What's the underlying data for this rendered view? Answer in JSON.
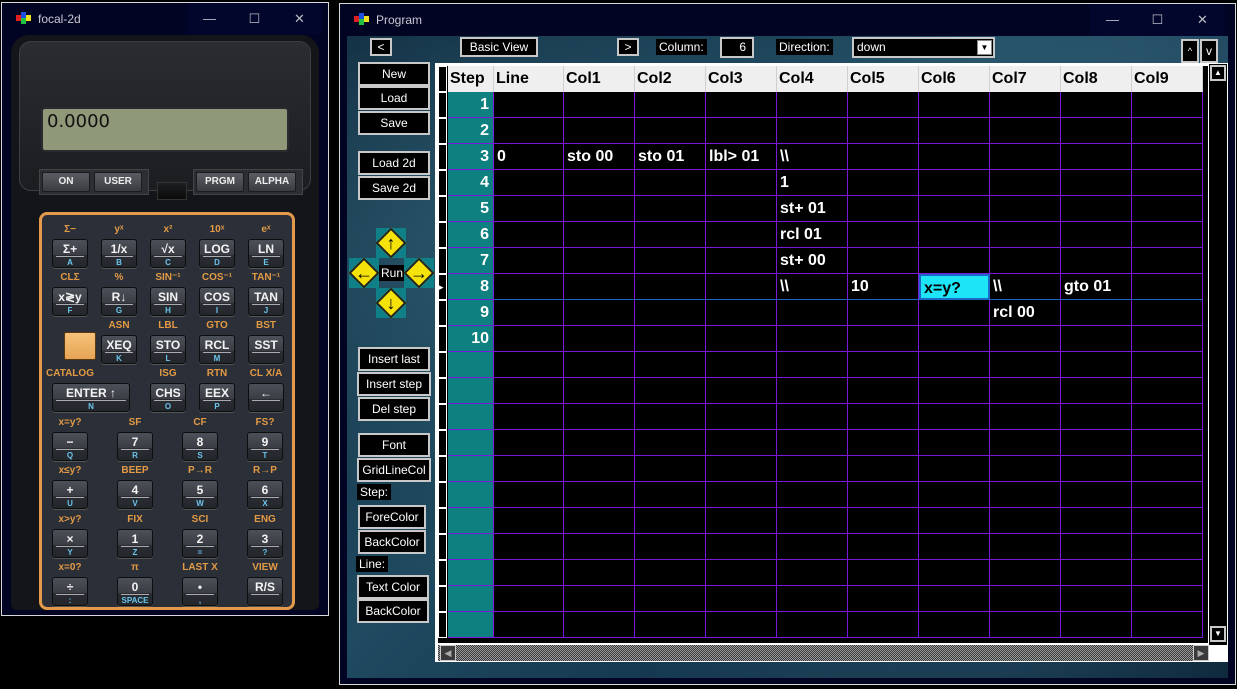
{
  "calculator_window": {
    "title": "focal-2d",
    "controls": {
      "minimize": "—",
      "maximize": "☐",
      "close": "✕"
    },
    "display": "0.0000",
    "top_buttons": [
      "ON",
      "USER",
      "PRGM",
      "ALPHA"
    ],
    "keys": [
      {
        "main": "Σ+",
        "sub": "A",
        "shift": "Σ−"
      },
      {
        "main": "1/x",
        "sub": "B",
        "shift": "yˣ"
      },
      {
        "main": "√x",
        "sub": "C",
        "shift": "x²"
      },
      {
        "main": "LOG",
        "sub": "D",
        "shift": "10ˣ"
      },
      {
        "main": "LN",
        "sub": "E",
        "shift": "eˣ"
      },
      {
        "main": "x≷y",
        "sub": "F",
        "shift": "CLΣ"
      },
      {
        "main": "R↓",
        "sub": "G",
        "shift": "%"
      },
      {
        "main": "SIN",
        "sub": "H",
        "shift": "SIN⁻¹"
      },
      {
        "main": "COS",
        "sub": "I",
        "shift": "COS⁻¹"
      },
      {
        "main": "TAN",
        "sub": "J",
        "shift": "TAN⁻¹"
      },
      {
        "main": "XEQ",
        "sub": "K",
        "shift": "ASN"
      },
      {
        "main": "STO",
        "sub": "L",
        "shift": "LBL"
      },
      {
        "main": "RCL",
        "sub": "M",
        "shift": "GTO"
      },
      {
        "main": "SST",
        "sub": "",
        "shift": "BST"
      },
      {
        "main": "ENTER ↑",
        "sub": "N",
        "shift": "CATALOG"
      },
      {
        "main": "CHS",
        "sub": "O",
        "shift": "ISG"
      },
      {
        "main": "EEX",
        "sub": "P",
        "shift": "RTN"
      },
      {
        "main": "←",
        "sub": "",
        "shift": "CL X/A"
      },
      {
        "main": "−",
        "sub": "Q",
        "shift": "x=y?"
      },
      {
        "main": "7",
        "sub": "R",
        "shift": "SF"
      },
      {
        "main": "8",
        "sub": "S",
        "shift": "CF"
      },
      {
        "main": "9",
        "sub": "T",
        "shift": "FS?"
      },
      {
        "main": "+",
        "sub": "U",
        "shift": "x≤y?"
      },
      {
        "main": "4",
        "sub": "V",
        "shift": "BEEP"
      },
      {
        "main": "5",
        "sub": "W",
        "shift": "P→R"
      },
      {
        "main": "6",
        "sub": "X",
        "shift": "R→P"
      },
      {
        "main": "×",
        "sub": "Y",
        "shift": "x>y?"
      },
      {
        "main": "1",
        "sub": "Z",
        "shift": "FIX"
      },
      {
        "main": "2",
        "sub": "=",
        "shift": "SCI"
      },
      {
        "main": "3",
        "sub": "?",
        "shift": "ENG"
      },
      {
        "main": "÷",
        "sub": ":",
        "shift": "x=0?"
      },
      {
        "main": "0",
        "sub": "SPACE",
        "shift": "π"
      },
      {
        "main": "•",
        "sub": ",",
        "shift": "LAST X"
      },
      {
        "main": "R/S",
        "sub": "",
        "shift": "VIEW"
      }
    ],
    "colors": {
      "shift_label": "#e29a45",
      "alpha_label": "#6bc6ee",
      "bezel": "#e39a4a",
      "lcd": "#8f9878"
    }
  },
  "program_window": {
    "title": "Program",
    "controls": {
      "minimize": "—",
      "maximize": "☐",
      "close": "✕"
    },
    "toolbar": {
      "prev": "<",
      "basic_view": "Basic View",
      "next": ">",
      "column_label": "Column:",
      "column_value": "6",
      "direction_label": "Direction:",
      "direction_value": "down",
      "scroll_up": "^",
      "scroll_down": "v"
    },
    "side_buttons": {
      "new": "New",
      "load": "Load",
      "save": "Save",
      "load2d": "Load 2d",
      "save2d": "Save 2d",
      "run": "Run",
      "insert_last": "Insert last",
      "insert_step": "Insert step",
      "del_step": "Del step",
      "font": "Font",
      "gridlinecol": "GridLineCol",
      "step_label": "Step:",
      "step_forecolor": "ForeColor",
      "step_backcolor": "BackColor",
      "line_label": "Line:",
      "line_textcolor": "Text Color",
      "line_backcolor": "BackColor"
    },
    "grid": {
      "headers": [
        "Step",
        "Line",
        "Col1",
        "Col2",
        "Col3",
        "Col4",
        "Col5",
        "Col6",
        "Col7",
        "Col8",
        "Col9"
      ],
      "selected_row": 8,
      "selected_col": "Col6",
      "rows": [
        {
          "step": "1",
          "cells": [
            "",
            "",
            "",
            "",
            "",
            "",
            "",
            "",
            "",
            ""
          ]
        },
        {
          "step": "2",
          "cells": [
            "",
            "",
            "",
            "",
            "",
            "",
            "",
            "",
            "",
            ""
          ]
        },
        {
          "step": "3",
          "cells": [
            "0",
            "sto 00",
            "sto 01",
            "lbl> 01",
            "\\\\",
            "",
            "",
            "",
            "",
            ""
          ]
        },
        {
          "step": "4",
          "cells": [
            "",
            "",
            "",
            "",
            "1",
            "",
            "",
            "",
            "",
            ""
          ]
        },
        {
          "step": "5",
          "cells": [
            "",
            "",
            "",
            "",
            "st+ 01",
            "",
            "",
            "",
            "",
            ""
          ]
        },
        {
          "step": "6",
          "cells": [
            "",
            "",
            "",
            "",
            "rcl 01",
            "",
            "",
            "",
            "",
            ""
          ]
        },
        {
          "step": "7",
          "cells": [
            "",
            "",
            "",
            "",
            "st+ 00",
            "",
            "",
            "",
            "",
            ""
          ]
        },
        {
          "step": "8",
          "cells": [
            "",
            "",
            "",
            "",
            "\\\\",
            "10",
            "x=y?",
            "\\\\",
            "gto 01",
            ""
          ]
        },
        {
          "step": "9",
          "cells": [
            "",
            "",
            "",
            "",
            "",
            "",
            "",
            "rcl 00",
            "",
            ""
          ]
        },
        {
          "step": "10",
          "cells": [
            "",
            "",
            "",
            "",
            "",
            "",
            "",
            "",
            "",
            ""
          ]
        },
        {
          "step": "",
          "cells": [
            "",
            "",
            "",
            "",
            "",
            "",
            "",
            "",
            "",
            ""
          ]
        },
        {
          "step": "",
          "cells": [
            "",
            "",
            "",
            "",
            "",
            "",
            "",
            "",
            "",
            ""
          ]
        },
        {
          "step": "",
          "cells": [
            "",
            "",
            "",
            "",
            "",
            "",
            "",
            "",
            "",
            ""
          ]
        },
        {
          "step": "",
          "cells": [
            "",
            "",
            "",
            "",
            "",
            "",
            "",
            "",
            "",
            ""
          ]
        },
        {
          "step": "",
          "cells": [
            "",
            "",
            "",
            "",
            "",
            "",
            "",
            "",
            "",
            ""
          ]
        },
        {
          "step": "",
          "cells": [
            "",
            "",
            "",
            "",
            "",
            "",
            "",
            "",
            "",
            ""
          ]
        },
        {
          "step": "",
          "cells": [
            "",
            "",
            "",
            "",
            "",
            "",
            "",
            "",
            "",
            ""
          ]
        },
        {
          "step": "",
          "cells": [
            "",
            "",
            "",
            "",
            "",
            "",
            "",
            "",
            "",
            ""
          ]
        },
        {
          "step": "",
          "cells": [
            "",
            "",
            "",
            "",
            "",
            "",
            "",
            "",
            "",
            ""
          ]
        },
        {
          "step": "",
          "cells": [
            "",
            "",
            "",
            "",
            "",
            "",
            "",
            "",
            "",
            ""
          ]
        },
        {
          "step": "",
          "cells": [
            "",
            "",
            "",
            "",
            "",
            "",
            "",
            "",
            "",
            ""
          ]
        }
      ],
      "colors": {
        "step_back": "#0e8080",
        "grid_line": "#7a18e0",
        "selected_cell": "#1ee4f8",
        "cell_text": "#ffffff"
      }
    },
    "icons": {
      "up": "arrow-up-icon",
      "down": "arrow-down-icon",
      "left": "arrow-left-icon",
      "right": "arrow-right-icon"
    }
  }
}
